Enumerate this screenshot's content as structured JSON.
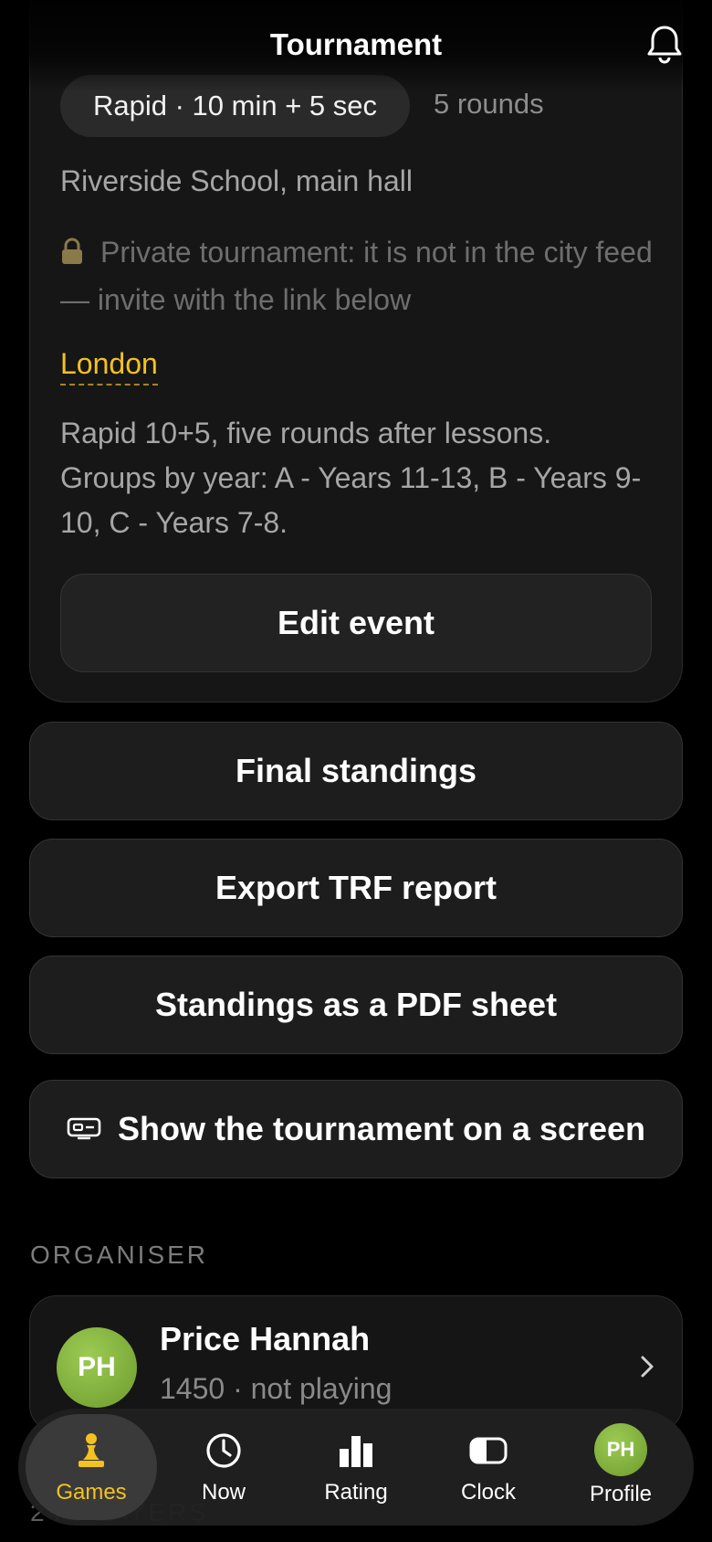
{
  "header": {
    "title": "Tournament"
  },
  "event": {
    "time_control": "Rapid · 10 min + 5 sec",
    "rounds": "5 rounds",
    "venue": "Riverside School, main hall",
    "private_note": "Private tournament: it is not in the city feed — invite with the link below",
    "city": "London",
    "description": "Rapid 10+5, five rounds after lessons. Groups by year: A - Years 11-13, B - Years 9-10, C - Years 7-8.",
    "edit_label": "Edit event"
  },
  "actions": {
    "final_standings": "Final standings",
    "export_trf": "Export TRF report",
    "pdf_sheet": "Standings as a PDF sheet",
    "show_screen": "Show the tournament on a screen"
  },
  "organiser": {
    "section_label": "ORGANISER",
    "initials": "PH",
    "name": "Price Hannah",
    "meta": "1450 · not playing"
  },
  "players_section_peek": "24 PLAYERS",
  "tabs": [
    {
      "label": "Games",
      "icon": "pawn-icon",
      "active": true
    },
    {
      "label": "Now",
      "icon": "clock-icon",
      "active": false
    },
    {
      "label": "Rating",
      "icon": "bar-chart-icon",
      "active": false
    },
    {
      "label": "Clock",
      "icon": "chess-clock-icon",
      "active": false
    },
    {
      "label": "Profile",
      "icon": "avatar",
      "initials": "PH",
      "active": false
    }
  ],
  "colors": {
    "accent": "#f4c21e",
    "avatar": "#8bbb43",
    "card": "#161616"
  }
}
